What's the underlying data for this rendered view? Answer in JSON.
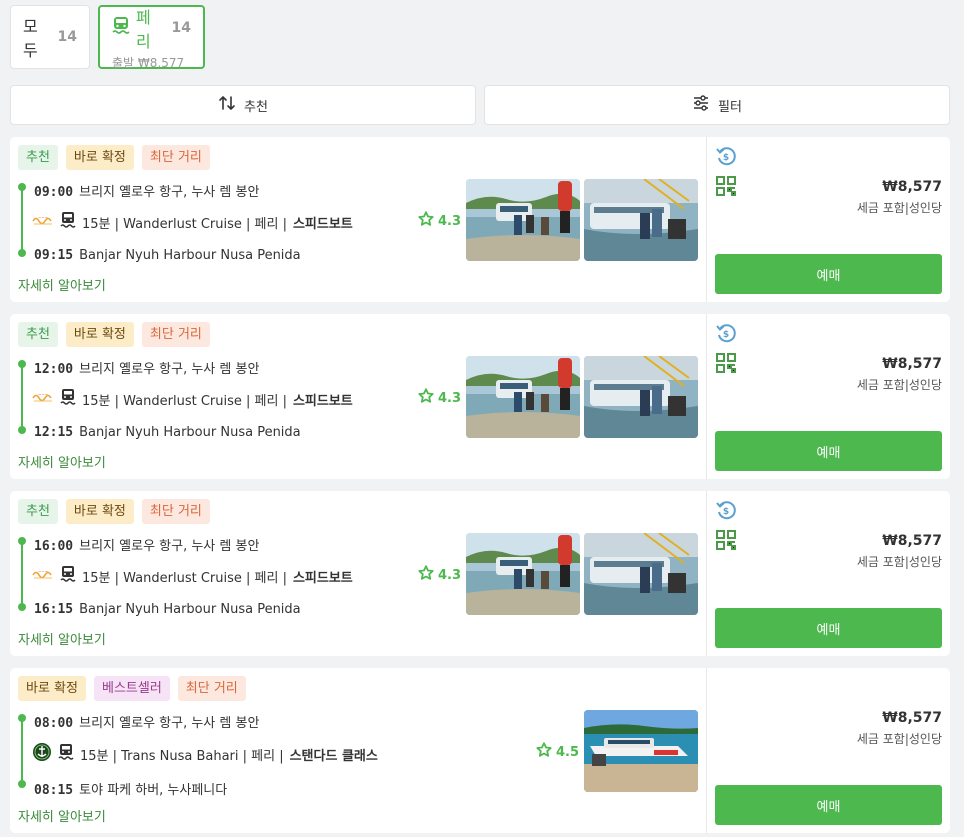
{
  "tabs": {
    "all": {
      "label": "모두",
      "count": "14"
    },
    "ferry": {
      "label": "페리",
      "count": "14",
      "sub": "출발 ₩8,577"
    }
  },
  "toolbar": {
    "sort_label": "추천",
    "filter_label": "필터"
  },
  "colors": {
    "accent": "#4cb84e"
  },
  "cards": [
    {
      "badges": [
        "추천",
        "바로 확정",
        "최단 거리"
      ],
      "dep_time": "09:00",
      "dep_place": "브리지 옐로우 항구, 누사 렘 봉안",
      "info": "15분 | Wanderlust Cruise | 페리 |",
      "class": "스피드보트",
      "arr_time": "09:15",
      "arr_place": "Banjar Nyuh Harbour Nusa Penida",
      "more": "자세히 알아보기",
      "rating": "4.3",
      "price": "₩8,577",
      "price_note": "세금 포함|성인당",
      "buy": "예매"
    },
    {
      "badges": [
        "추천",
        "바로 확정",
        "최단 거리"
      ],
      "dep_time": "12:00",
      "dep_place": "브리지 옐로우 항구, 누사 렘 봉안",
      "info": "15분 | Wanderlust Cruise | 페리 |",
      "class": "스피드보트",
      "arr_time": "12:15",
      "arr_place": "Banjar Nyuh Harbour Nusa Penida",
      "more": "자세히 알아보기",
      "rating": "4.3",
      "price": "₩8,577",
      "price_note": "세금 포함|성인당",
      "buy": "예매"
    },
    {
      "badges": [
        "추천",
        "바로 확정",
        "최단 거리"
      ],
      "dep_time": "16:00",
      "dep_place": "브리지 옐로우 항구, 누사 렘 봉안",
      "info": "15분 | Wanderlust Cruise | 페리 |",
      "class": "스피드보트",
      "arr_time": "16:15",
      "arr_place": "Banjar Nyuh Harbour Nusa Penida",
      "more": "자세히 알아보기",
      "rating": "4.3",
      "price": "₩8,577",
      "price_note": "세금 포함|성인당",
      "buy": "예매"
    },
    {
      "badges": [
        "바로 확정",
        "베스트셀러",
        "최단 거리"
      ],
      "dep_time": "08:00",
      "dep_place": "브리지 옐로우 항구, 누사 렘 봉안",
      "info": "15분 | Trans Nusa Bahari | 페리 |",
      "class": "스탠다드 클래스",
      "arr_time": "08:15",
      "arr_place": "토야 파케 하버, 누사페니다",
      "more": "자세히 알아보기",
      "rating": "4.5",
      "price": "₩8,577",
      "price_note": "세금 포함|성인당",
      "buy": "예매"
    }
  ]
}
